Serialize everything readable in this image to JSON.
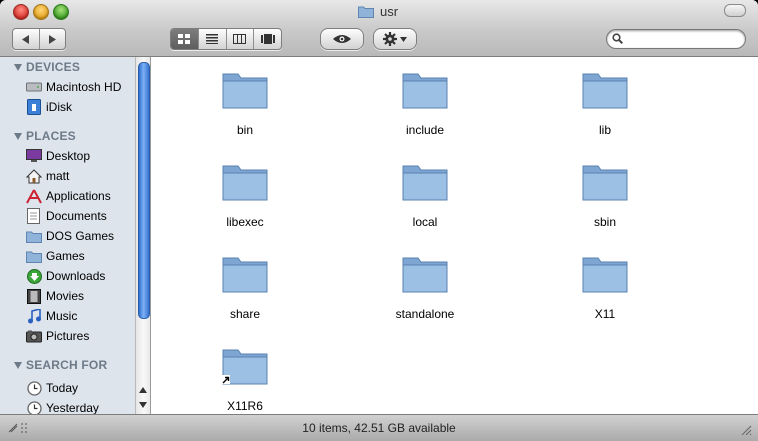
{
  "window": {
    "title": "usr"
  },
  "toolbar": {
    "back_icon": "back-arrow-icon",
    "forward_icon": "forward-arrow-icon",
    "view_modes": [
      "icon-view",
      "list-view",
      "column-view",
      "cover-flow-view"
    ],
    "active_view": "icon-view",
    "search_placeholder": ""
  },
  "sidebar": {
    "devices_header": "DEVICES",
    "devices": [
      {
        "label": "Macintosh HD",
        "icon": "hard-drive-icon"
      },
      {
        "label": "iDisk",
        "icon": "idisk-icon"
      }
    ],
    "places_header": "PLACES",
    "places": [
      {
        "label": "Desktop",
        "icon": "desktop-icon"
      },
      {
        "label": "matt",
        "icon": "home-icon"
      },
      {
        "label": "Applications",
        "icon": "applications-icon"
      },
      {
        "label": "Documents",
        "icon": "documents-icon"
      },
      {
        "label": "DOS Games",
        "icon": "folder-icon"
      },
      {
        "label": "Games",
        "icon": "folder-icon"
      },
      {
        "label": "Downloads",
        "icon": "downloads-icon"
      },
      {
        "label": "Movies",
        "icon": "movies-icon"
      },
      {
        "label": "Music",
        "icon": "music-icon"
      },
      {
        "label": "Pictures",
        "icon": "pictures-icon"
      }
    ],
    "search_header": "SEARCH FOR",
    "searches": [
      {
        "label": "Today",
        "icon": "clock-icon"
      },
      {
        "label": "Yesterday",
        "icon": "clock-icon"
      }
    ]
  },
  "files": [
    {
      "name": "bin"
    },
    {
      "name": "include"
    },
    {
      "name": "lib"
    },
    {
      "name": "libexec"
    },
    {
      "name": "local"
    },
    {
      "name": "sbin"
    },
    {
      "name": "share"
    },
    {
      "name": "standalone"
    },
    {
      "name": "X11"
    },
    {
      "name": "X11R6",
      "alias": true
    }
  ],
  "status": {
    "text": "10 items, 42.51 GB available"
  },
  "colors": {
    "folder": "#8fb3d9",
    "sidebar": "#dde4ec",
    "scroll_thumb": "#4a86db"
  }
}
